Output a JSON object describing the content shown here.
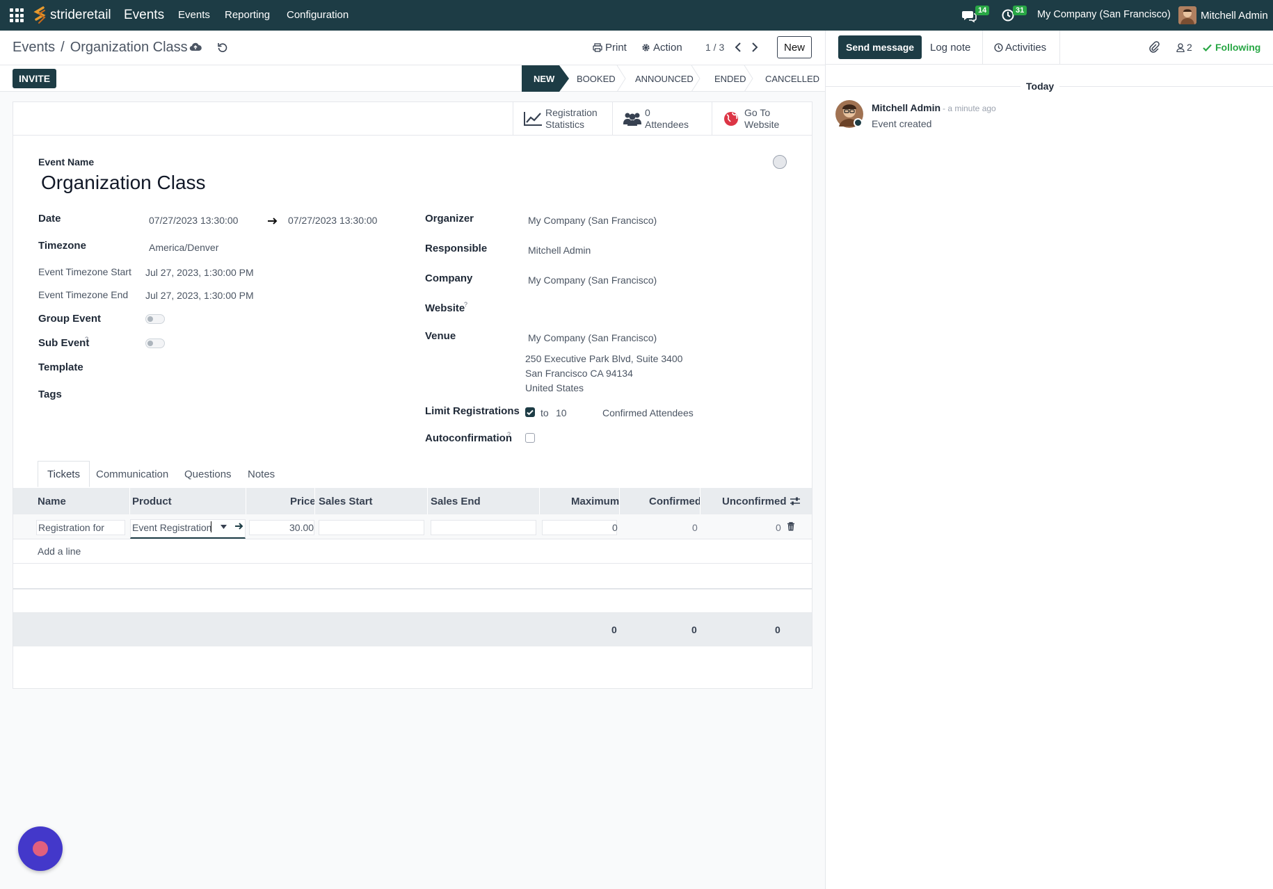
{
  "topnav": {
    "brand": "strideretail",
    "app": "Events",
    "menu": [
      "Events",
      "Reporting",
      "Configuration"
    ],
    "messages_count": "14",
    "activities_count": "31",
    "company": "My Company (San Francisco)",
    "user": "Mitchell Admin"
  },
  "control": {
    "breadcrumb_parent": "Events",
    "breadcrumb_sep": "/",
    "breadcrumb_current": "Organization Class",
    "print": "Print",
    "action": "Action",
    "pager": "1 / 3",
    "new": "New"
  },
  "statusbar": {
    "invite": "INVITE",
    "stages": [
      "NEW",
      "BOOKED",
      "ANNOUNCED",
      "ENDED",
      "CANCELLED"
    ],
    "active_stage": "NEW"
  },
  "smart_buttons": {
    "stats_1": "Registration",
    "stats_2": "Statistics",
    "attendees_count": "0",
    "attendees_label": "Attendees",
    "website_1": "Go To",
    "website_2": "Website"
  },
  "form": {
    "event_name_label": "Event Name",
    "event_name": "Organization Class",
    "date_label": "Date",
    "date_start": "07/27/2023 13:30:00",
    "date_end": "07/27/2023 13:30:00",
    "timezone_label": "Timezone",
    "timezone": "America/Denver",
    "tz_start_label": "Event Timezone Start",
    "tz_start": "Jul 27, 2023, 1:30:00 PM",
    "tz_end_label": "Event Timezone End",
    "tz_end": "Jul 27, 2023, 1:30:00 PM",
    "group_event_label": "Group Event",
    "sub_event_label": "Sub Event",
    "template_label": "Template",
    "tags_label": "Tags",
    "organizer_label": "Organizer",
    "organizer": "My Company (San Francisco)",
    "responsible_label": "Responsible",
    "responsible": "Mitchell Admin",
    "company_label": "Company",
    "company": "My Company (San Francisco)",
    "website_label": "Website",
    "venue_label": "Venue",
    "venue": "My Company (San Francisco)",
    "venue_street": "250 Executive Park Blvd, Suite 3400",
    "venue_city": "San Francisco CA 94134",
    "venue_country": "United States",
    "limit_label": "Limit Registrations",
    "limit_to": "to",
    "limit_value": "10",
    "limit_suffix": "Confirmed Attendees",
    "autoconf_label": "Autoconfirmation",
    "help_mark": "?"
  },
  "tabs": [
    "Tickets",
    "Communication",
    "Questions",
    "Notes"
  ],
  "tickets": {
    "columns": [
      "Name",
      "Product",
      "Price",
      "Sales Start",
      "Sales End",
      "Maximum",
      "Confirmed",
      "Unconfirmed"
    ],
    "row": {
      "name": "Registration for",
      "product": "Event Registration",
      "price": "30.00",
      "sales_start": "",
      "sales_end": "",
      "maximum": "0",
      "confirmed": "0",
      "unconfirmed": "0"
    },
    "add_line": "Add a line",
    "totals": [
      "0",
      "0",
      "0"
    ]
  },
  "chatter": {
    "send_message": "Send message",
    "log_note": "Log note",
    "activities": "Activities",
    "followers_count": "2",
    "following": "Following",
    "date_separator": "Today",
    "message_author": "Mitchell Admin",
    "message_time": "- a minute ago",
    "message_body": "Event created"
  },
  "colors": {
    "brand": "#1d3c45",
    "accent": "#28a745",
    "bubble": "#4338ca"
  }
}
